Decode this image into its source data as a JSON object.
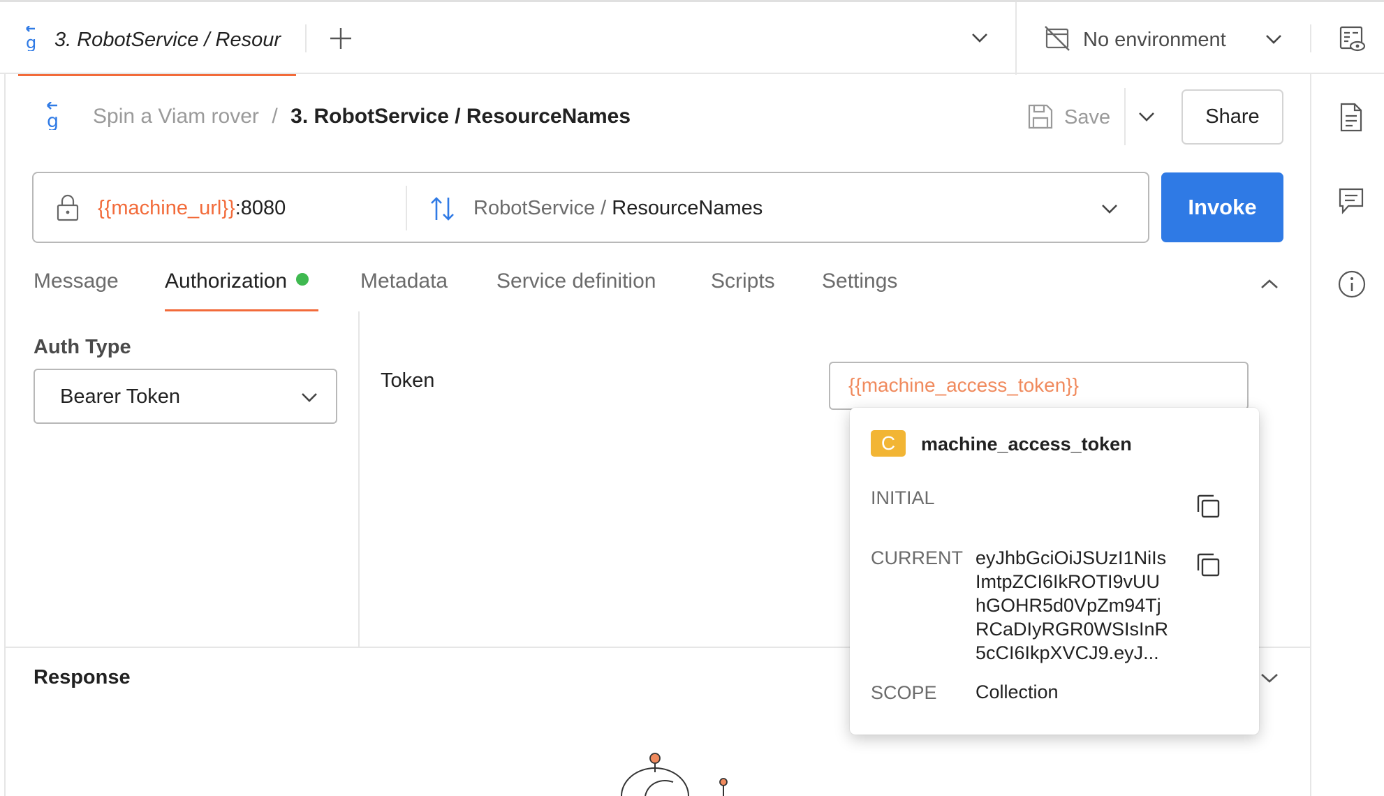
{
  "tab": {
    "title": "3. RobotService / Resour",
    "new_tab": "+"
  },
  "environment": {
    "label": "No environment"
  },
  "breadcrumb": {
    "collection": "Spin a Viam rover",
    "separator": "/",
    "request": "3. RobotService / ResourceNames"
  },
  "toolbar": {
    "save_label": "Save",
    "share_label": "Share"
  },
  "url": {
    "variable": "{{machine_url}}",
    "port": ":8080",
    "service": "RobotService",
    "method_separator": "/",
    "method": "ResourceNames"
  },
  "invoke_label": "Invoke",
  "request_tabs": [
    {
      "label": "Message"
    },
    {
      "label": "Authorization",
      "indicator_color": "#3fb950"
    },
    {
      "label": "Metadata"
    },
    {
      "label": "Service definition"
    },
    {
      "label": "Scripts"
    },
    {
      "label": "Settings"
    }
  ],
  "auth": {
    "type_heading": "Auth Type",
    "type_value": "Bearer Token",
    "token_label": "Token",
    "token_value": "{{machine_access_token}}"
  },
  "variable_popover": {
    "badge": "C",
    "name": "machine_access_token",
    "initial_label": "INITIAL",
    "initial_value": "",
    "current_label": "CURRENT",
    "current_lines": [
      "eyJhbGciOiJSUzI1NiIs",
      "ImtpZCI6IkROTI9vUU",
      "hGOHR5d0VpZm94Tj",
      "RCaDIyRGR0WSIsInR",
      "5cCI6IkpXVCJ9.eyJ..."
    ],
    "scope_label": "SCOPE",
    "scope_value": "Collection"
  },
  "response": {
    "heading": "Response"
  },
  "colors": {
    "accent": "#f26b3a",
    "primary": "#2f7ae5",
    "variable": "#f26b3a",
    "badge": "#f2b534",
    "success": "#3fb950"
  }
}
